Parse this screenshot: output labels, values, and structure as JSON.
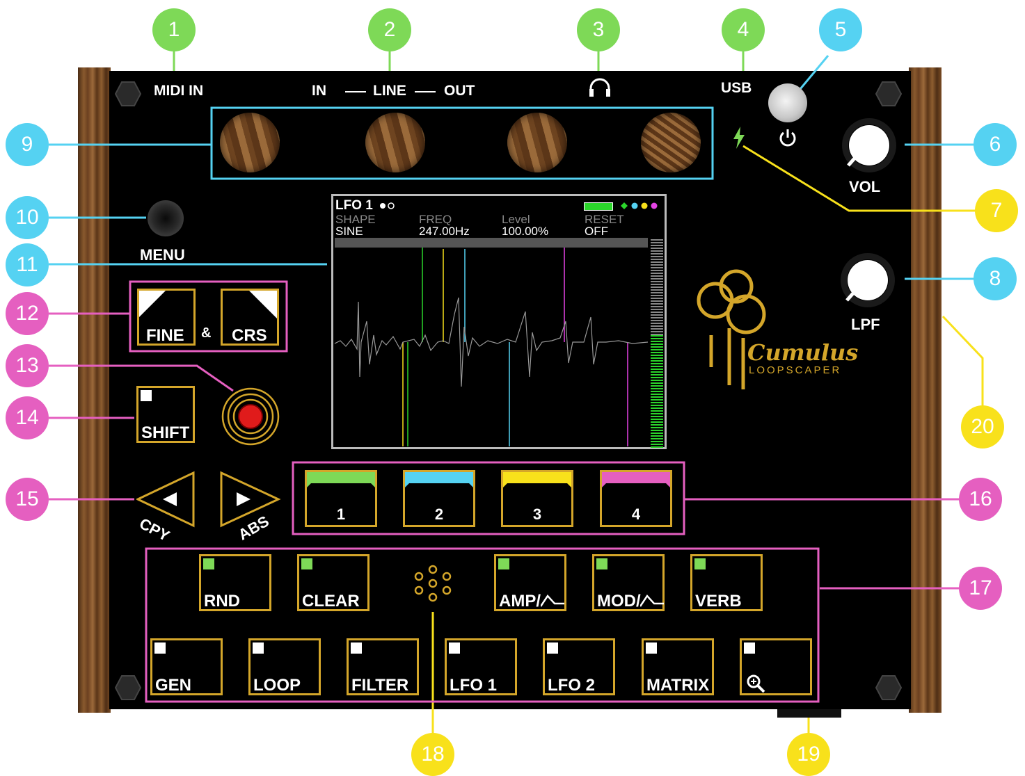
{
  "device": {
    "brand": "Cumulus",
    "model": "LOOPSCAPER"
  },
  "panel": {
    "midi_in": "MIDI IN",
    "line_in": "IN",
    "line": "LINE",
    "line_out": "OUT",
    "usb": "USB",
    "vol": "VOL",
    "lpf": "LPF",
    "menu": "MENU",
    "amp": "&",
    "cpy": "CPY",
    "abs": "ABS"
  },
  "buttons": {
    "fine": "FINE",
    "crs": "CRS",
    "shift": "SHIFT",
    "rnd": "RND",
    "clear": "CLEAR",
    "amp_env": "AMP/",
    "mod_env": "MOD/",
    "verb": "VERB",
    "gen": "GEN",
    "loop": "LOOP",
    "filter": "FILTER",
    "lfo1": "LFO 1",
    "lfo2": "LFO 2",
    "matrix": "MATRIX"
  },
  "channels": [
    {
      "label": "1",
      "color": "#7ed957"
    },
    {
      "label": "2",
      "color": "#55d2f2"
    },
    {
      "label": "3",
      "color": "#f8e11b"
    },
    {
      "label": "4",
      "color": "#e55fc0"
    }
  ],
  "screen": {
    "title": "LFO 1",
    "params": [
      {
        "name": "SHAPE",
        "value": "SINE"
      },
      {
        "name": "FREQ",
        "value": "247.00Hz"
      },
      {
        "name": "Level",
        "value": "100.00%"
      },
      {
        "name": "RESET",
        "value": "OFF"
      }
    ]
  },
  "callouts": [
    {
      "n": "1",
      "color": "#7ed957"
    },
    {
      "n": "2",
      "color": "#7ed957"
    },
    {
      "n": "3",
      "color": "#7ed957"
    },
    {
      "n": "4",
      "color": "#7ed957"
    },
    {
      "n": "5",
      "color": "#55d2f2"
    },
    {
      "n": "6",
      "color": "#55d2f2"
    },
    {
      "n": "7",
      "color": "#f8e11b"
    },
    {
      "n": "8",
      "color": "#55d2f2"
    },
    {
      "n": "9",
      "color": "#55d2f2"
    },
    {
      "n": "10",
      "color": "#55d2f2"
    },
    {
      "n": "11",
      "color": "#55d2f2"
    },
    {
      "n": "12",
      "color": "#e55fc0"
    },
    {
      "n": "13",
      "color": "#e55fc0"
    },
    {
      "n": "14",
      "color": "#e55fc0"
    },
    {
      "n": "15",
      "color": "#e55fc0"
    },
    {
      "n": "16",
      "color": "#e55fc0"
    },
    {
      "n": "17",
      "color": "#e55fc0"
    },
    {
      "n": "18",
      "color": "#f8e11b"
    },
    {
      "n": "19",
      "color": "#f8e11b"
    },
    {
      "n": "20",
      "color": "#f8e11b"
    }
  ]
}
